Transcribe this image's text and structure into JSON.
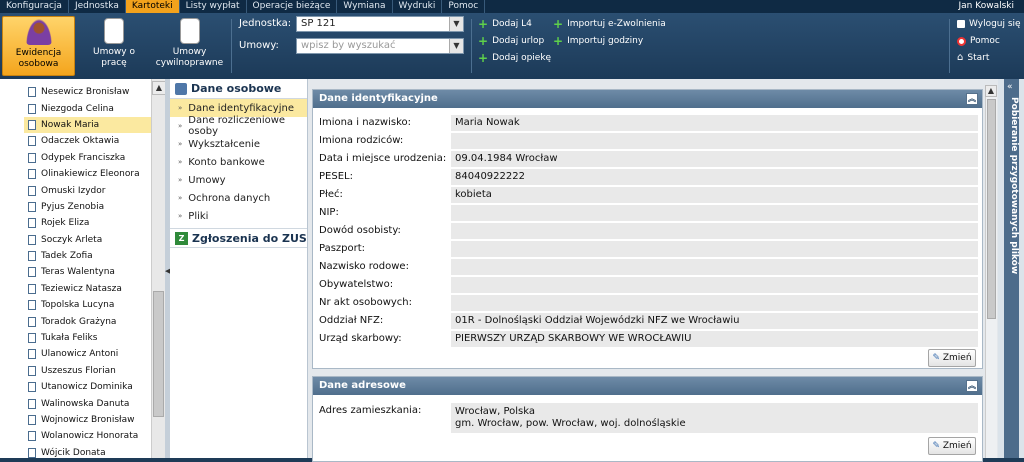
{
  "menu": {
    "tabs": [
      "Konfiguracja",
      "Jednostka",
      "Kartoteki",
      "Listy wypłat",
      "Operacje bieżące",
      "Wymiana",
      "Wydruki",
      "Pomoc"
    ],
    "active": "Kartoteki",
    "user": "Jan Kowalski"
  },
  "ribbon": {
    "btn_ewidencja": "Ewidencja osobowa",
    "btn_umowy_prace": "Umowy o pracę",
    "btn_umowy_cyw": "Umowy cywilnoprawne",
    "jednostka_label": "Jednostka:",
    "jednostka_value": "SP 121",
    "umowy_label": "Umowy:",
    "umowy_placeholder": "wpisz by wyszukać",
    "dodaj_l4": "Dodaj L4",
    "dodaj_urlop": "Dodaj urlop",
    "dodaj_opieke": "Dodaj opiekę",
    "importuj_ezw": "Importuj e-Zwolnienia",
    "importuj_godz": "Importuj godziny",
    "wyloguj": "Wyloguj się",
    "pomoc": "Pomoc",
    "start": "Start"
  },
  "employees": [
    "Nesewicz Bronisław",
    "Niezgoda Celina",
    "Nowak Maria",
    "Odaczek Oktawia",
    "Odypek Franciszka",
    "Olinakiewicz Eleonora",
    "Omuski Izydor",
    "Pyjus Zenobia",
    "Rojek Eliza",
    "Soczyk Arleta",
    "Tadek Zofia",
    "Teras Walentyna",
    "Teziewicz Natasza",
    "Topolska Lucyna",
    "Toradok Grażyna",
    "Tukała Feliks",
    "Ulanowicz Antoni",
    "Uszeszus Florian",
    "Utanowicz Dominika",
    "Walinowska Danuta",
    "Wojnowicz Bronisław",
    "Wolanowicz Honorata",
    "Wójcik Donata"
  ],
  "selected_employee": "Nowak Maria",
  "nav": {
    "header": "Dane osobowe",
    "items": [
      "Dane identyfikacyjne",
      "Dane rozliczeniowe osoby",
      "Wykształcenie",
      "Konto bankowe",
      "Umowy",
      "Ochrona danych",
      "Pliki"
    ],
    "selected": "Dane identyfikacyjne",
    "zus": "Zgłoszenia do ZUS"
  },
  "panel1": {
    "title": "Dane identyfikacyjne",
    "rows": [
      {
        "label": "Imiona i nazwisko:",
        "value": "Maria Nowak"
      },
      {
        "label": "Imiona rodziców:",
        "value": ""
      },
      {
        "label": "Data i miejsce urodzenia:",
        "value": "09.04.1984 Wrocław"
      },
      {
        "label": "PESEL:",
        "value": "84040922222"
      },
      {
        "label": "Płeć:",
        "value": "kobieta"
      },
      {
        "label": "NIP:",
        "value": ""
      },
      {
        "label": "Dowód osobisty:",
        "value": ""
      },
      {
        "label": "Paszport:",
        "value": ""
      },
      {
        "label": "Nazwisko rodowe:",
        "value": ""
      },
      {
        "label": "Obywatelstwo:",
        "value": ""
      },
      {
        "label": "Nr akt osobowych:",
        "value": ""
      },
      {
        "label": "Oddział NFZ:",
        "value": "01R - Dolnośląski Oddział Wojewódzki NFZ we Wrocławiu"
      },
      {
        "label": "Urząd skarbowy:",
        "value": "PIERWSZY URZĄD SKARBOWY WE WROCŁAWIU"
      }
    ],
    "edit": "Zmień"
  },
  "panel2": {
    "title": "Dane adresowe",
    "label": "Adres zamieszkania:",
    "line1": "Wrocław, Polska",
    "line2": "gm. Wrocław, pow. Wrocław, woj. dolnośląskie",
    "edit": "Zmień"
  },
  "side": {
    "label": "Pobieranie przygotowanych plików"
  },
  "colors": {
    "accent": "#f3a21c",
    "header": "#1c3a58",
    "selected": "#fbe9a0"
  }
}
